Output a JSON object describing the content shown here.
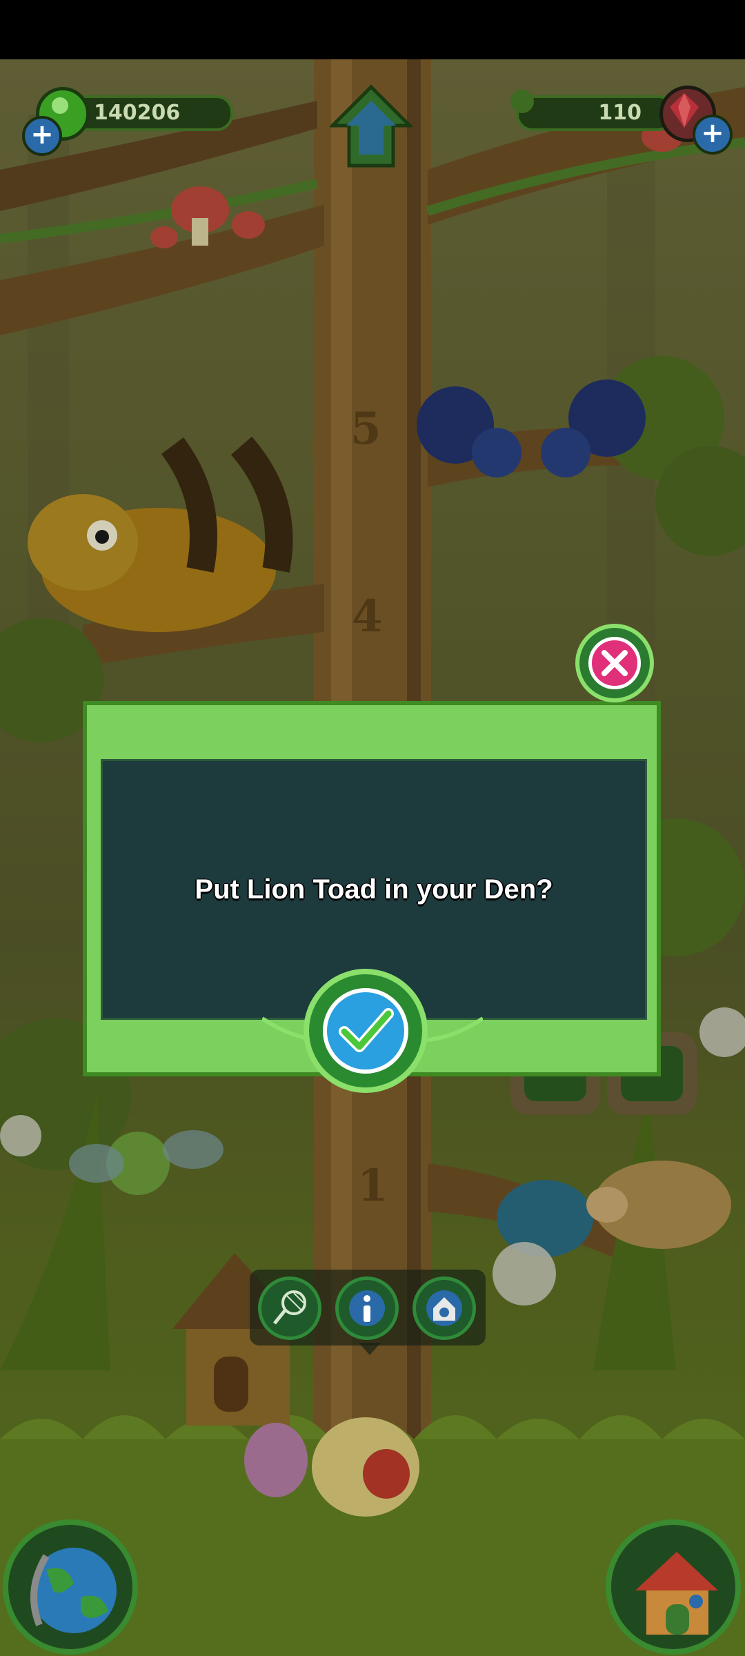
{
  "hud": {
    "coins": "140206",
    "gems": "110"
  },
  "dialog": {
    "message": "Put Lion Toad in your Den?"
  },
  "tree": {
    "level_markers": [
      "5",
      "4",
      "1"
    ]
  },
  "colors": {
    "dialog_frame": "#7bd05e",
    "dialog_panel": "#1d3a3d",
    "confirm_button": "#2aa0e0",
    "close_button": "#e0307a"
  },
  "icons": {
    "action_bar": [
      "net-icon",
      "info-icon",
      "den-icon"
    ],
    "corners": [
      "globe-icon",
      "house-icon"
    ]
  }
}
